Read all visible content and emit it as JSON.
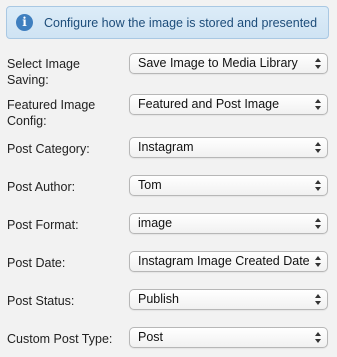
{
  "banner": {
    "text": "Configure how the image is stored and presented",
    "icon": "info-icon"
  },
  "fields": [
    {
      "label_line1": "Select Image",
      "label_line2": "Saving:",
      "value": "Save Image to Media Library"
    },
    {
      "label_line1": "Featured Image",
      "label_line2": "Config:",
      "value": "Featured and Post Image"
    },
    {
      "label": "Post Category:",
      "value": "Instagram"
    },
    {
      "label": "Post Author:",
      "value": "Tom"
    },
    {
      "label": "Post Format:",
      "value": "image"
    },
    {
      "label": "Post Date:",
      "value": "Instagram Image Created Date"
    },
    {
      "label": "Post Status:",
      "value": "Publish"
    },
    {
      "label": "Custom Post Type:",
      "value": "Post"
    }
  ]
}
